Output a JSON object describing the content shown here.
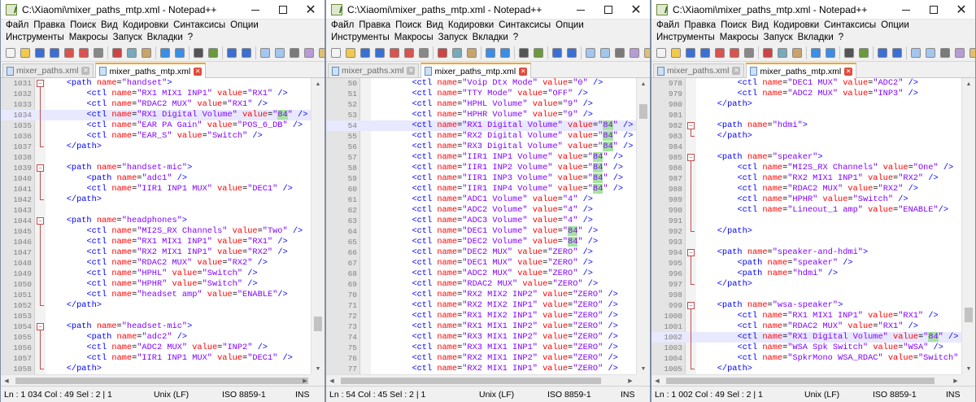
{
  "windows": [
    {
      "id": "w1",
      "title": "C:\\Xiaomi\\mixer_paths_mtp.xml - Notepad++",
      "menu": [
        "Файл",
        "Правка",
        "Поиск",
        "Вид",
        "Кодировки",
        "Синтаксисы",
        "Опции",
        "Инструменты",
        "Макросы",
        "Запуск",
        "Вкладки",
        "?"
      ],
      "tabs": [
        {
          "label": "mixer_paths.xml",
          "active": false
        },
        {
          "label": "mixer_paths_mtp.xml",
          "active": true
        }
      ],
      "lines": [
        {
          "n": "1031",
          "text": "    <path name=\"handset\">"
        },
        {
          "n": "1032",
          "text": "        <ctl name=\"RX1 MIX1 INP1\" value=\"RX1\" />"
        },
        {
          "n": "1033",
          "text": "        <ctl name=\"RDAC2 MUX\" value=\"RX1\" />"
        },
        {
          "n": "1034",
          "text": "        <ctl name=\"RX1 Digital Volume\" value=\"84\" />",
          "hl": true
        },
        {
          "n": "1035",
          "text": "        <ctl name=\"EAR PA Gain\" value=\"POS_6_DB\" />"
        },
        {
          "n": "1036",
          "text": "        <ctl name=\"EAR_S\" value=\"Switch\" />"
        },
        {
          "n": "1037",
          "text": "    </path>"
        },
        {
          "n": "1038",
          "text": ""
        },
        {
          "n": "1039",
          "text": "    <path name=\"handset-mic\">"
        },
        {
          "n": "1040",
          "text": "        <path name=\"adc1\" />"
        },
        {
          "n": "1041",
          "text": "        <ctl name=\"IIR1 INP1 MUX\" value=\"DEC1\" />"
        },
        {
          "n": "1042",
          "text": "    </path>"
        },
        {
          "n": "1043",
          "text": ""
        },
        {
          "n": "1044",
          "text": "    <path name=\"headphones\">"
        },
        {
          "n": "1045",
          "text": "        <ctl name=\"MI2S_RX Channels\" value=\"Two\" />"
        },
        {
          "n": "1046",
          "text": "        <ctl name=\"RX1 MIX1 INP1\" value=\"RX1\" />"
        },
        {
          "n": "1047",
          "text": "        <ctl name=\"RX2 MIX1 INP1\" value=\"RX2\" />"
        },
        {
          "n": "1048",
          "text": "        <ctl name=\"RDAC2 MUX\" value=\"RX2\" />"
        },
        {
          "n": "1049",
          "text": "        <ctl name=\"HPHL\" value=\"Switch\" />"
        },
        {
          "n": "1050",
          "text": "        <ctl name=\"HPHR\" value=\"Switch\" />"
        },
        {
          "n": "1051",
          "text": "        <ctl name=\"headset amp\" value=\"ENABLE\"/>"
        },
        {
          "n": "1052",
          "text": "    </path>"
        },
        {
          "n": "1053",
          "text": ""
        },
        {
          "n": "1054",
          "text": "    <path name=\"headset-mic\">"
        },
        {
          "n": "1055",
          "text": "        <path name=\"adc2\" />"
        },
        {
          "n": "1056",
          "text": "        <ctl name=\"ADC2 MUX\" value=\"INP2\" />"
        },
        {
          "n": "1057",
          "text": "        <ctl name=\"IIR1 INP1 MUX\" value=\"DEC1\" />"
        },
        {
          "n": "1058",
          "text": "    </path>"
        }
      ],
      "status": {
        "pos": "Ln : 1 034    Col : 49    Sel : 2 | 1",
        "eol": "Unix (LF)",
        "enc": "ISO 8859-1",
        "mode": "INS"
      }
    },
    {
      "id": "w2",
      "title": "C:\\Xiaomi\\mixer_paths_mtp.xml - Notepad++",
      "menu": [
        "Файл",
        "Правка",
        "Поиск",
        "Вид",
        "Кодировки",
        "Синтаксисы",
        "Опции",
        "Инструменты",
        "Макросы",
        "Запуск",
        "Вкладки",
        "?"
      ],
      "tabs": [
        {
          "label": "mixer_paths.xml",
          "active": false
        },
        {
          "label": "mixer_paths_mtp.xml",
          "active": true
        }
      ],
      "lines": [
        {
          "n": "50",
          "text": "        <ctl name=\"Voip Dtx Mode\" value=\"0\" />"
        },
        {
          "n": "51",
          "text": "        <ctl name=\"TTY Mode\" value=\"OFF\" />"
        },
        {
          "n": "52",
          "text": "        <ctl name=\"HPHL Volume\" value=\"9\" />"
        },
        {
          "n": "53",
          "text": "        <ctl name=\"HPHR Volume\" value=\"9\" />"
        },
        {
          "n": "54",
          "text": "        <ctl name=\"RX1 Digital Volume\" value=\"84\" />",
          "hl": true
        },
        {
          "n": "55",
          "text": "        <ctl name=\"RX2 Digital Volume\" value=\"84\" />"
        },
        {
          "n": "56",
          "text": "        <ctl name=\"RX3 Digital Volume\" value=\"84\" />"
        },
        {
          "n": "57",
          "text": "        <ctl name=\"IIR1 INP1 Volume\" value=\"84\" />"
        },
        {
          "n": "58",
          "text": "        <ctl name=\"IIR1 INP2 Volume\" value=\"84\" />"
        },
        {
          "n": "59",
          "text": "        <ctl name=\"IIR1 INP3 Volume\" value=\"84\" />"
        },
        {
          "n": "60",
          "text": "        <ctl name=\"IIR1 INP4 Volume\" value=\"84\" />"
        },
        {
          "n": "61",
          "text": "        <ctl name=\"ADC1 Volume\" value=\"4\" />"
        },
        {
          "n": "62",
          "text": "        <ctl name=\"ADC2 Volume\" value=\"4\" />"
        },
        {
          "n": "63",
          "text": "        <ctl name=\"ADC3 Volume\" value=\"4\" />"
        },
        {
          "n": "64",
          "text": "        <ctl name=\"DEC1 Volume\" value=\"84\" />"
        },
        {
          "n": "65",
          "text": "        <ctl name=\"DEC2 Volume\" value=\"84\" />"
        },
        {
          "n": "66",
          "text": "        <ctl name=\"DEC2 MUX\" value=\"ZERO\" />"
        },
        {
          "n": "67",
          "text": "        <ctl name=\"DEC1 MUX\" value=\"ZERO\" />"
        },
        {
          "n": "68",
          "text": "        <ctl name=\"ADC2 MUX\" value=\"ZERO\" />"
        },
        {
          "n": "69",
          "text": "        <ctl name=\"RDAC2 MUX\" value=\"ZERO\" />"
        },
        {
          "n": "70",
          "text": "        <ctl name=\"RX2 MIX2 INP2\" value=\"ZERO\" />"
        },
        {
          "n": "71",
          "text": "        <ctl name=\"RX2 MIX2 INP1\" value=\"ZERO\" />"
        },
        {
          "n": "72",
          "text": "        <ctl name=\"RX1 MIX2 INP1\" value=\"ZERO\" />"
        },
        {
          "n": "73",
          "text": "        <ctl name=\"RX1 MIX1 INP2\" value=\"ZERO\" />"
        },
        {
          "n": "74",
          "text": "        <ctl name=\"RX3 MIX1 INP2\" value=\"ZERO\" />"
        },
        {
          "n": "75",
          "text": "        <ctl name=\"RX3 MIX1 INP1\" value=\"ZERO\" />"
        },
        {
          "n": "76",
          "text": "        <ctl name=\"RX2 MIX1 INP2\" value=\"ZERO\" />"
        },
        {
          "n": "77",
          "text": "        <ctl name=\"RX2 MIX1 INP1\" value=\"ZERO\" />"
        }
      ],
      "status": {
        "pos": "Ln : 54    Col : 45    Sel : 2 | 1",
        "eol": "Unix (LF)",
        "enc": "ISO 8859-1",
        "mode": "INS"
      }
    },
    {
      "id": "w3",
      "title": "C:\\Xiaomi\\mixer_paths_mtp.xml - Notepad++",
      "menu": [
        "Файл",
        "Правка",
        "Поиск",
        "Вид",
        "Кодировки",
        "Синтаксисы",
        "Опции",
        "Инструменты",
        "Макросы",
        "Запуск",
        "Вкладки",
        "?"
      ],
      "tabs": [
        {
          "label": "mixer_paths.xml",
          "active": false
        },
        {
          "label": "mixer_paths_mtp.xml",
          "active": true
        }
      ],
      "lines": [
        {
          "n": "978",
          "text": "        <ctl name=\"DEC1 MUX\" value=\"ADC2\" />"
        },
        {
          "n": "979",
          "text": "        <ctl name=\"ADC2 MUX\" value=\"INP3\" />"
        },
        {
          "n": "980",
          "text": "    </path>"
        },
        {
          "n": "981",
          "text": ""
        },
        {
          "n": "982",
          "text": "    <path name=\"hdmi\">"
        },
        {
          "n": "983",
          "text": "    </path>"
        },
        {
          "n": "984",
          "text": ""
        },
        {
          "n": "985",
          "text": "    <path name=\"speaker\">"
        },
        {
          "n": "986",
          "text": "        <ctl name=\"MI2S_RX Channels\" value=\"One\" />"
        },
        {
          "n": "987",
          "text": "        <ctl name=\"RX2 MIX1 INP1\" value=\"RX2\" />"
        },
        {
          "n": "988",
          "text": "        <ctl name=\"RDAC2 MUX\" value=\"RX2\" />"
        },
        {
          "n": "989",
          "text": "        <ctl name=\"HPHR\" value=\"Switch\" />"
        },
        {
          "n": "990",
          "text": "        <ctl name=\"Lineout_1 amp\" value=\"ENABLE\"/>"
        },
        {
          "n": "991",
          "text": ""
        },
        {
          "n": "992",
          "text": "    </path>"
        },
        {
          "n": "993",
          "text": ""
        },
        {
          "n": "994",
          "text": "    <path name=\"speaker-and-hdmi\">"
        },
        {
          "n": "995",
          "text": "        <path name=\"speaker\" />"
        },
        {
          "n": "996",
          "text": "        <path name=\"hdmi\" />"
        },
        {
          "n": "997",
          "text": "    </path>"
        },
        {
          "n": "998",
          "text": ""
        },
        {
          "n": "999",
          "text": "    <path name=\"wsa-speaker\">"
        },
        {
          "n": "1000",
          "text": "        <ctl name=\"RX1 MIX1 INP1\" value=\"RX1\" />"
        },
        {
          "n": "1001",
          "text": "        <ctl name=\"RDAC2 MUX\" value=\"RX1\" />"
        },
        {
          "n": "1002",
          "text": "        <ctl name=\"RX1 Digital Volume\" value=\"84\" />",
          "hl": true
        },
        {
          "n": "1003",
          "text": "        <ctl name=\"WSA Spk Switch\" value=\"WSA\" />"
        },
        {
          "n": "1004",
          "text": "        <ctl name=\"SpkrMono WSA_RDAC\" value=\"Switch\" />"
        },
        {
          "n": "1005",
          "text": "    </path>"
        }
      ],
      "status": {
        "pos": "Ln : 1 002    Col : 49    Sel : 2 | 1",
        "eol": "Unix (LF)",
        "enc": "ISO 8859-1",
        "mode": "INS"
      }
    }
  ],
  "icons": {
    "toolbar": [
      "new-file-icon",
      "open-file-icon",
      "save-icon",
      "save-all-icon",
      "close-icon",
      "close-all-icon",
      "print-icon",
      "cut-icon",
      "copy-icon",
      "paste-icon",
      "undo-icon",
      "redo-icon",
      "find-icon",
      "replace-icon",
      "zoom-in-icon",
      "zoom-out-icon",
      "sync-v-icon",
      "sync-h-icon",
      "wrap-icon",
      "indent-guide-icon",
      "show-all-icon"
    ]
  },
  "colors": {
    "tag": "#0000ff",
    "attr": "#ff0000",
    "value": "#8000ff",
    "linehl": "#e8e8ff",
    "mark": "#a6e3a1",
    "tabaccent": "#f5a623"
  }
}
